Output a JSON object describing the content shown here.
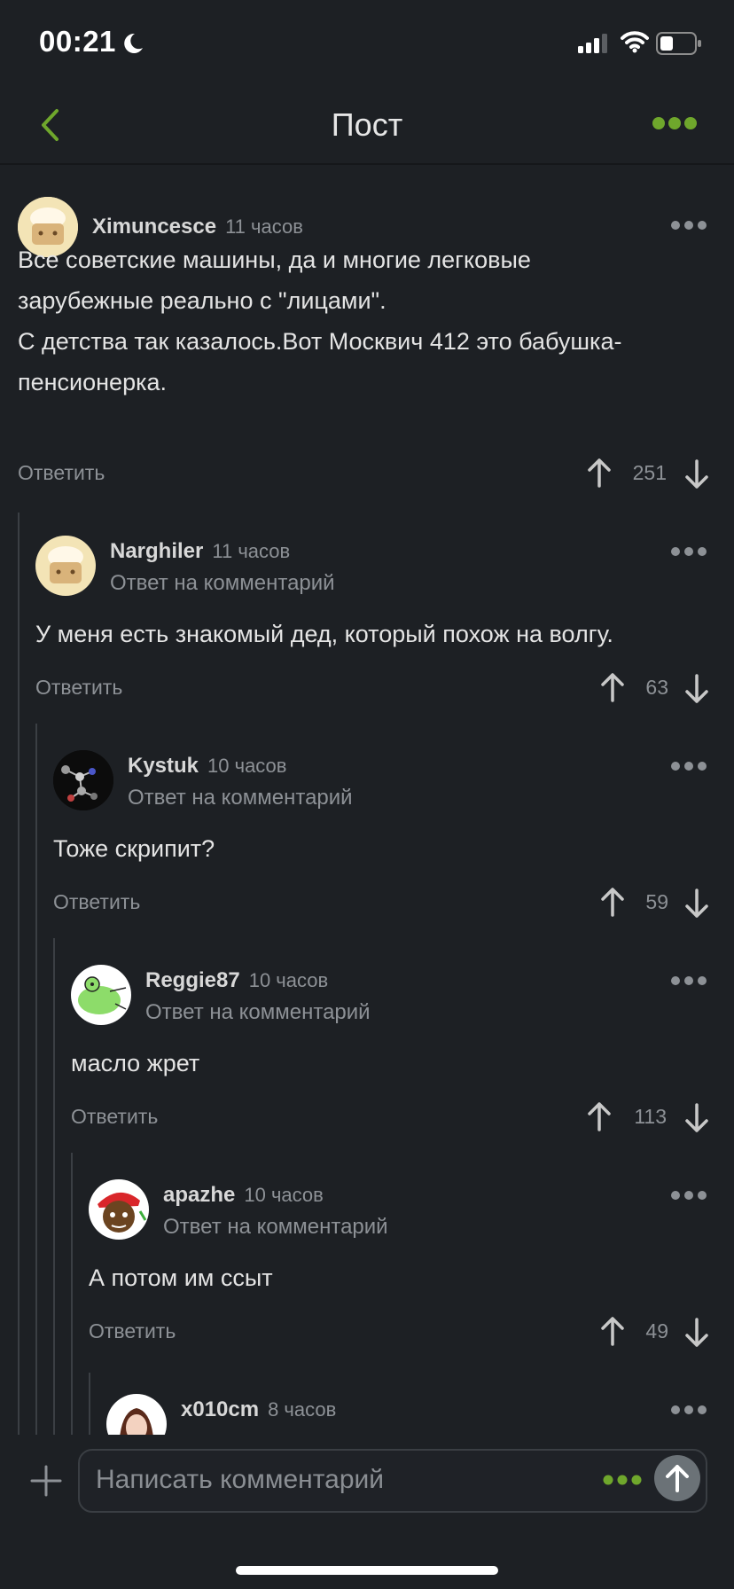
{
  "status": {
    "time": "00:21"
  },
  "nav": {
    "title": "Пост"
  },
  "labels": {
    "reply": "Ответить",
    "reply_to": "Ответ на комментарий"
  },
  "colors": {
    "accent": "#6fa72c",
    "bg": "#1d2024",
    "muted": "#8d9196"
  },
  "comments": [
    {
      "author": "Ximuncesce",
      "time": "11 часов",
      "text_lines": [
        "Все советские машины, да и многие легковые",
        "зарубежные реально с \"лицами\".",
        "С детства так казалось.Вот Москвич 412 это бабушка-",
        "пенсионерка."
      ],
      "votes": "251"
    },
    {
      "author": "Narghiler",
      "time": "11 часов",
      "text": "У меня есть знакомый дед, который похож на волгу.",
      "votes": "63"
    },
    {
      "author": "Kystuk",
      "time": "10 часов",
      "text": "Тоже скрипит?",
      "votes": "59"
    },
    {
      "author": "Reggie87",
      "time": "10 часов",
      "text": "масло жрет",
      "votes": "113"
    },
    {
      "author": "apazhe",
      "time": "10 часов",
      "text": "А потом им ссыт",
      "votes": "49"
    },
    {
      "author": "x010cm",
      "time": "8 часов"
    }
  ],
  "composer": {
    "placeholder": "Написать комментарий"
  },
  "icons": [
    "back-arrow-icon",
    "more-dots-icon",
    "upvote-icon",
    "downvote-icon",
    "plus-icon",
    "send-icon",
    "moon-icon",
    "signal-icon",
    "wifi-icon",
    "battery-icon"
  ]
}
